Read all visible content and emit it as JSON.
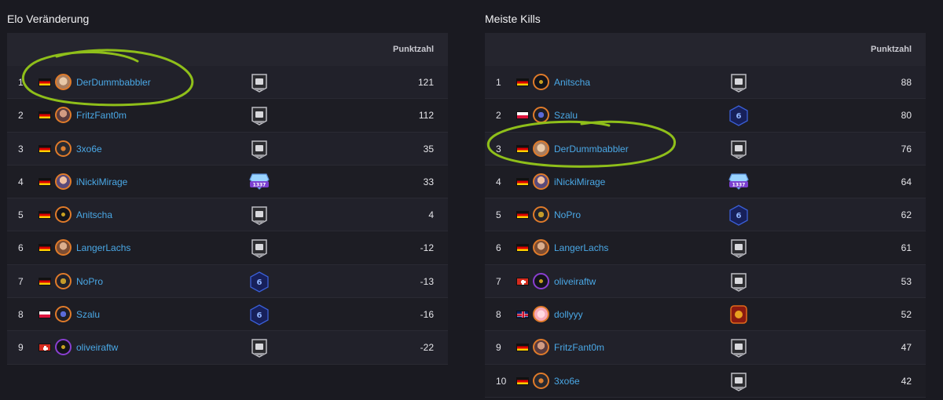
{
  "left_panel": {
    "title": "Elo Veränderung",
    "score_header": "Punktzahl",
    "rows": [
      {
        "rank": "1",
        "flag": "de",
        "avatar": "face1",
        "name": "DerDummbabbler",
        "badge": "silver",
        "score": "121"
      },
      {
        "rank": "2",
        "flag": "de",
        "avatar": "face2",
        "name": "FritzFant0m",
        "badge": "silver",
        "score": "112"
      },
      {
        "rank": "3",
        "flag": "de",
        "avatar": "face3",
        "name": "3xo6e",
        "badge": "silver",
        "score": "35"
      },
      {
        "rank": "4",
        "flag": "de",
        "avatar": "face4",
        "name": "iNickiMirage",
        "badge": "1337",
        "score": "33"
      },
      {
        "rank": "5",
        "flag": "de",
        "avatar": "face9",
        "name": "Anitscha",
        "badge": "silver",
        "score": "4"
      },
      {
        "rank": "6",
        "flag": "de",
        "avatar": "face6",
        "name": "LangerLachs",
        "badge": "silver",
        "score": "-12"
      },
      {
        "rank": "7",
        "flag": "de",
        "avatar": "face7",
        "name": "NoPro",
        "badge": "blue6",
        "score": "-13"
      },
      {
        "rank": "8",
        "flag": "pl",
        "avatar": "face8",
        "name": "Szalu",
        "badge": "blue6",
        "score": "-16"
      },
      {
        "rank": "9",
        "flag": "ch",
        "avatar": "face9",
        "name": "oliveiraftw",
        "badge": "silver",
        "score": "-22"
      }
    ]
  },
  "right_panel": {
    "title": "Meiste Kills",
    "score_header": "Punktzahl",
    "rows": [
      {
        "rank": "1",
        "flag": "de",
        "avatar": "face9",
        "name": "Anitscha",
        "badge": "silver",
        "score": "88"
      },
      {
        "rank": "2",
        "flag": "pl",
        "avatar": "face8",
        "name": "Szalu",
        "badge": "blue6",
        "score": "80"
      },
      {
        "rank": "3",
        "flag": "de",
        "avatar": "face1",
        "name": "DerDummbabbler",
        "badge": "silver",
        "score": "76"
      },
      {
        "rank": "4",
        "flag": "de",
        "avatar": "face4",
        "name": "iNickiMirage",
        "badge": "1337",
        "score": "64"
      },
      {
        "rank": "5",
        "flag": "de",
        "avatar": "face7",
        "name": "NoPro",
        "badge": "blue6",
        "score": "62"
      },
      {
        "rank": "6",
        "flag": "de",
        "avatar": "face6",
        "name": "LangerLachs",
        "badge": "silver",
        "score": "61"
      },
      {
        "rank": "7",
        "flag": "ch",
        "avatar": "face9",
        "name": "oliveiraftw",
        "badge": "silver",
        "score": "53"
      },
      {
        "rank": "8",
        "flag": "gb",
        "avatar": "face10",
        "name": "dollyyy",
        "badge": "red",
        "score": "52"
      },
      {
        "rank": "9",
        "flag": "de",
        "avatar": "face2",
        "name": "FritzFant0m",
        "badge": "silver",
        "score": "47"
      },
      {
        "rank": "10",
        "flag": "de",
        "avatar": "face3",
        "name": "3xo6e",
        "badge": "silver",
        "score": "42"
      }
    ]
  },
  "colors": {
    "background": "#1a1a21",
    "player_link": "#4aa8e6",
    "highlight_stroke": "#8fbf1a"
  }
}
